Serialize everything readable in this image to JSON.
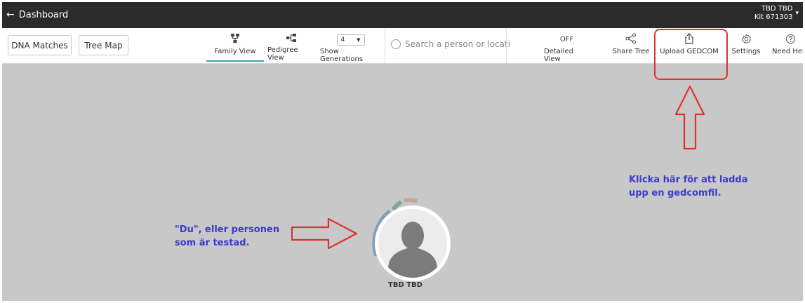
{
  "topbar": {
    "back_label": "Dashboard",
    "user_name": "TBD TBD",
    "kit_id": "Kit 671303"
  },
  "toolbar": {
    "dna_matches": "DNA Matches",
    "tree_map": "Tree Map",
    "family_view": "Family View",
    "pedigree_view": "Pedigree View",
    "generations_value": "4",
    "show_generations": "Show Generations",
    "search_placeholder": "Search a person or location",
    "detailed_state": "OFF",
    "detailed_view": "Detailed View",
    "share_tree": "Share Tree",
    "upload_gedcom": "Upload GEDCOM",
    "settings": "Settings",
    "need_help": "Need Help"
  },
  "annotations": {
    "upload_note_line1": "Klicka här för att ladda",
    "upload_note_line2": "upp en gedcomfil.",
    "person_note_line1": "\"Du\", eller personen",
    "person_note_line2": "som är testad."
  },
  "tree": {
    "person_name": "TBD TBD"
  },
  "colors": {
    "annotation_text": "#3a3ad0",
    "annotation_arrow": "#e23030",
    "active_tab": "#3aa0a8"
  }
}
